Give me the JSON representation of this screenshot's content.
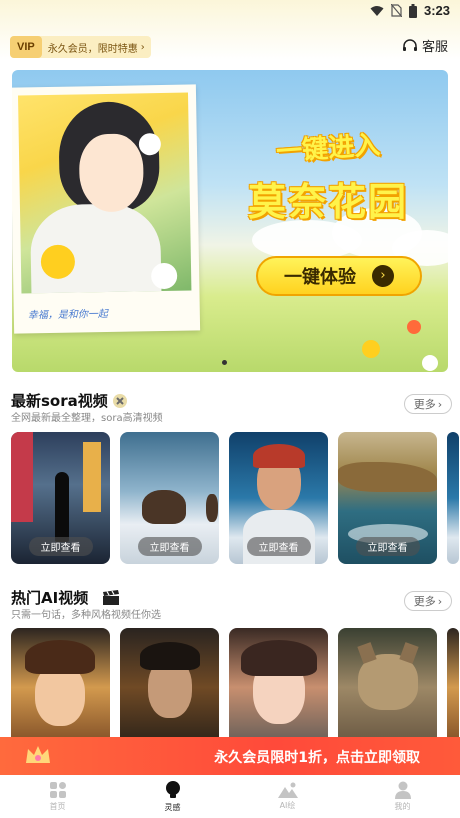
{
  "status_bar": {
    "time": "3:23"
  },
  "top_bar": {
    "vip_badge": "VIP",
    "vip_text": "永久会员，限时特惠",
    "service_label": "客服"
  },
  "banner": {
    "title_line1": "一键进入",
    "title_line2": "莫奈花园",
    "cta_label": "一键体验",
    "caption": "幸福，是和你一起"
  },
  "sections": [
    {
      "title": "最新sora视频",
      "subtitle": "全网最新最全整理，sora高清视频",
      "more_label": "更多",
      "card_action": "立即查看",
      "cards": [
        "city-night-walk",
        "mammoths-snow",
        "astronaut-portrait",
        "coastal-cliffs"
      ]
    },
    {
      "title": "热门AI视频",
      "subtitle": "只需一句话，多种风格视频任你选",
      "more_label": "更多",
      "cards": [
        "anime-fox-girl",
        "fantasy-warrior",
        "anime-girl-portrait",
        "tabby-cat"
      ]
    }
  ],
  "promo": {
    "text": "永久会员限时1折，点击立即领取"
  },
  "tabbar": {
    "items": [
      {
        "label": "首页",
        "icon": "grid-icon"
      },
      {
        "label": "灵感",
        "icon": "bulb-icon"
      },
      {
        "label": "AI绘",
        "icon": "mountain-icon"
      },
      {
        "label": "我的",
        "icon": "person-icon"
      }
    ],
    "active_index": 1
  },
  "colors": {
    "accent": "#ff4a3a",
    "vip_gold": "#f6cf73"
  }
}
